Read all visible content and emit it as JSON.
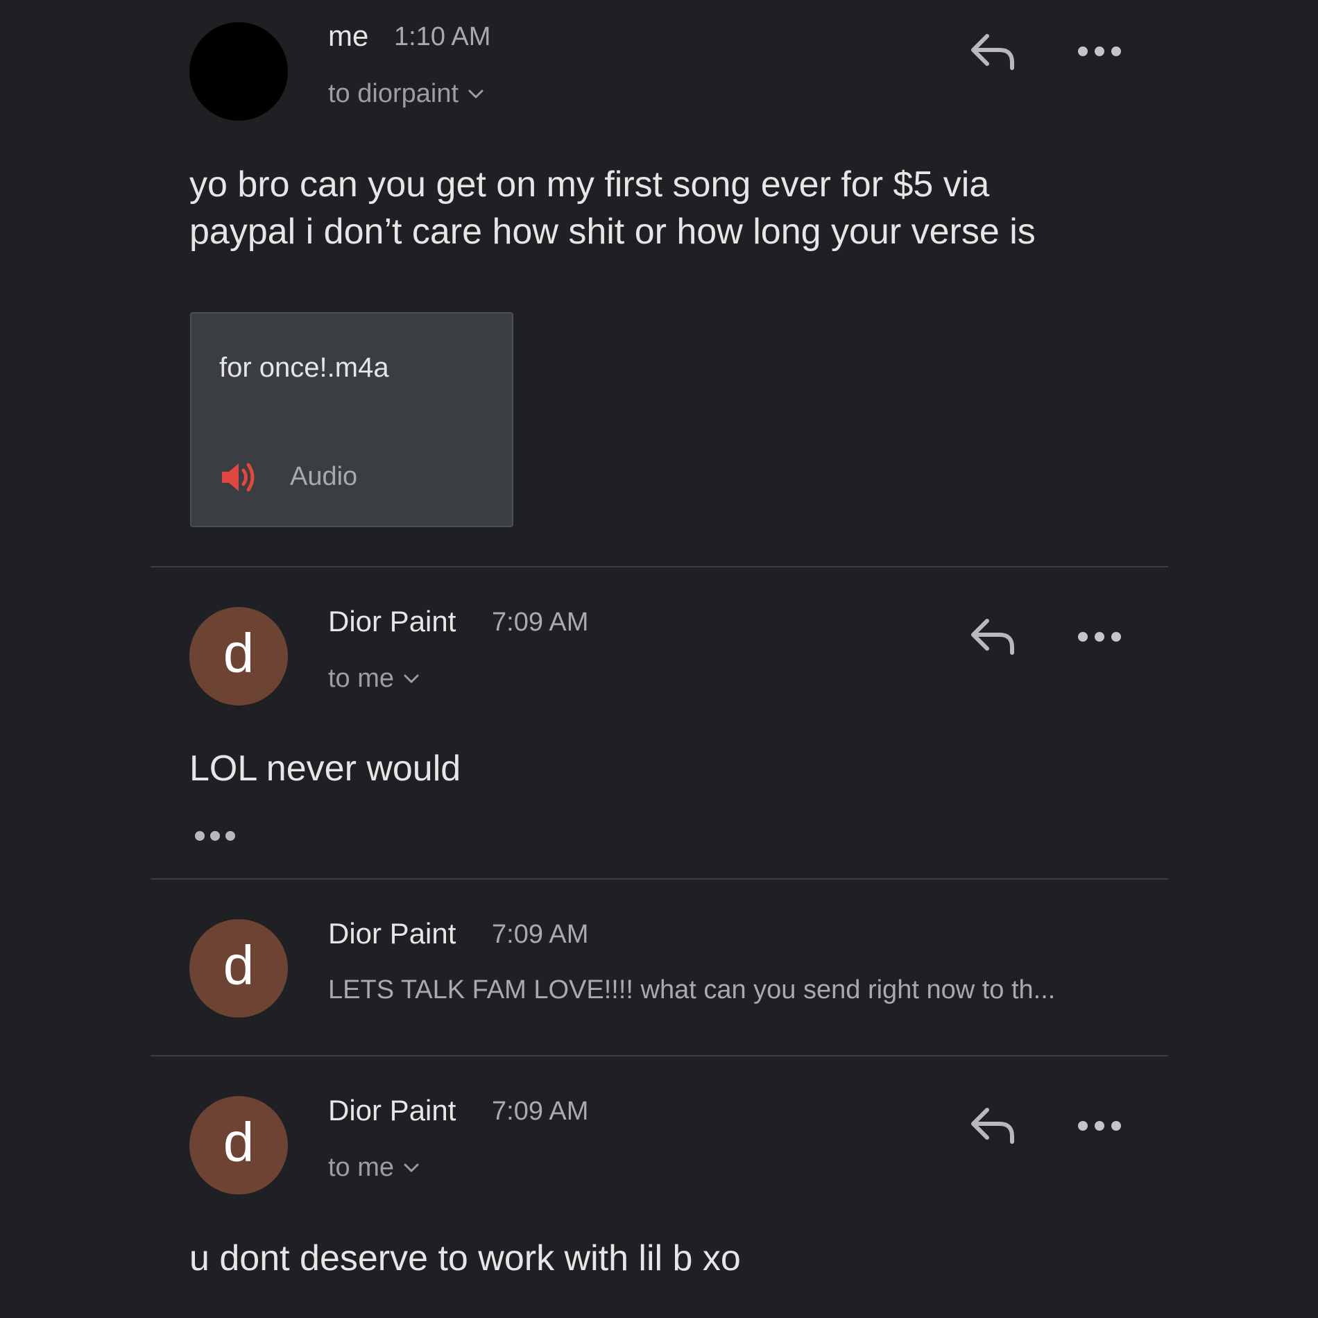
{
  "colors": {
    "background": "#1f2024",
    "avatar_me": "#000000",
    "avatar_dior": "#6d4334",
    "divider": "#3b3d41",
    "attachment_bg": "#3a3e42",
    "audio_icon": "#e0483e"
  },
  "icons": {
    "reply": "reply-icon",
    "more": "more-horizontal-icon",
    "chevron": "chevron-down-icon",
    "audio": "speaker-icon"
  },
  "thread": {
    "messages": [
      {
        "sender": "me",
        "time": "1:10 AM",
        "recipient": "to diorpaint",
        "avatar_letter": "",
        "body_lines": [
          "yo bro can you get on my first song ever for $5 via",
          "paypal i don’t care how shit or how long your verse is"
        ],
        "attachment": {
          "filename": "for once!.m4a",
          "type_label": "Audio"
        }
      },
      {
        "sender": "Dior Paint",
        "time": "7:09 AM",
        "recipient": "to me",
        "avatar_letter": "d",
        "body": "LOL never would"
      },
      {
        "sender": "Dior Paint",
        "time": "7:09 AM",
        "avatar_letter": "d",
        "snippet": "LETS TALK FAM LOVE!!!! what can you send right now to th..."
      },
      {
        "sender": "Dior Paint",
        "time": "7:09 AM",
        "recipient": "to me",
        "avatar_letter": "d",
        "body": "u dont deserve to work with lil b xo"
      }
    ]
  }
}
